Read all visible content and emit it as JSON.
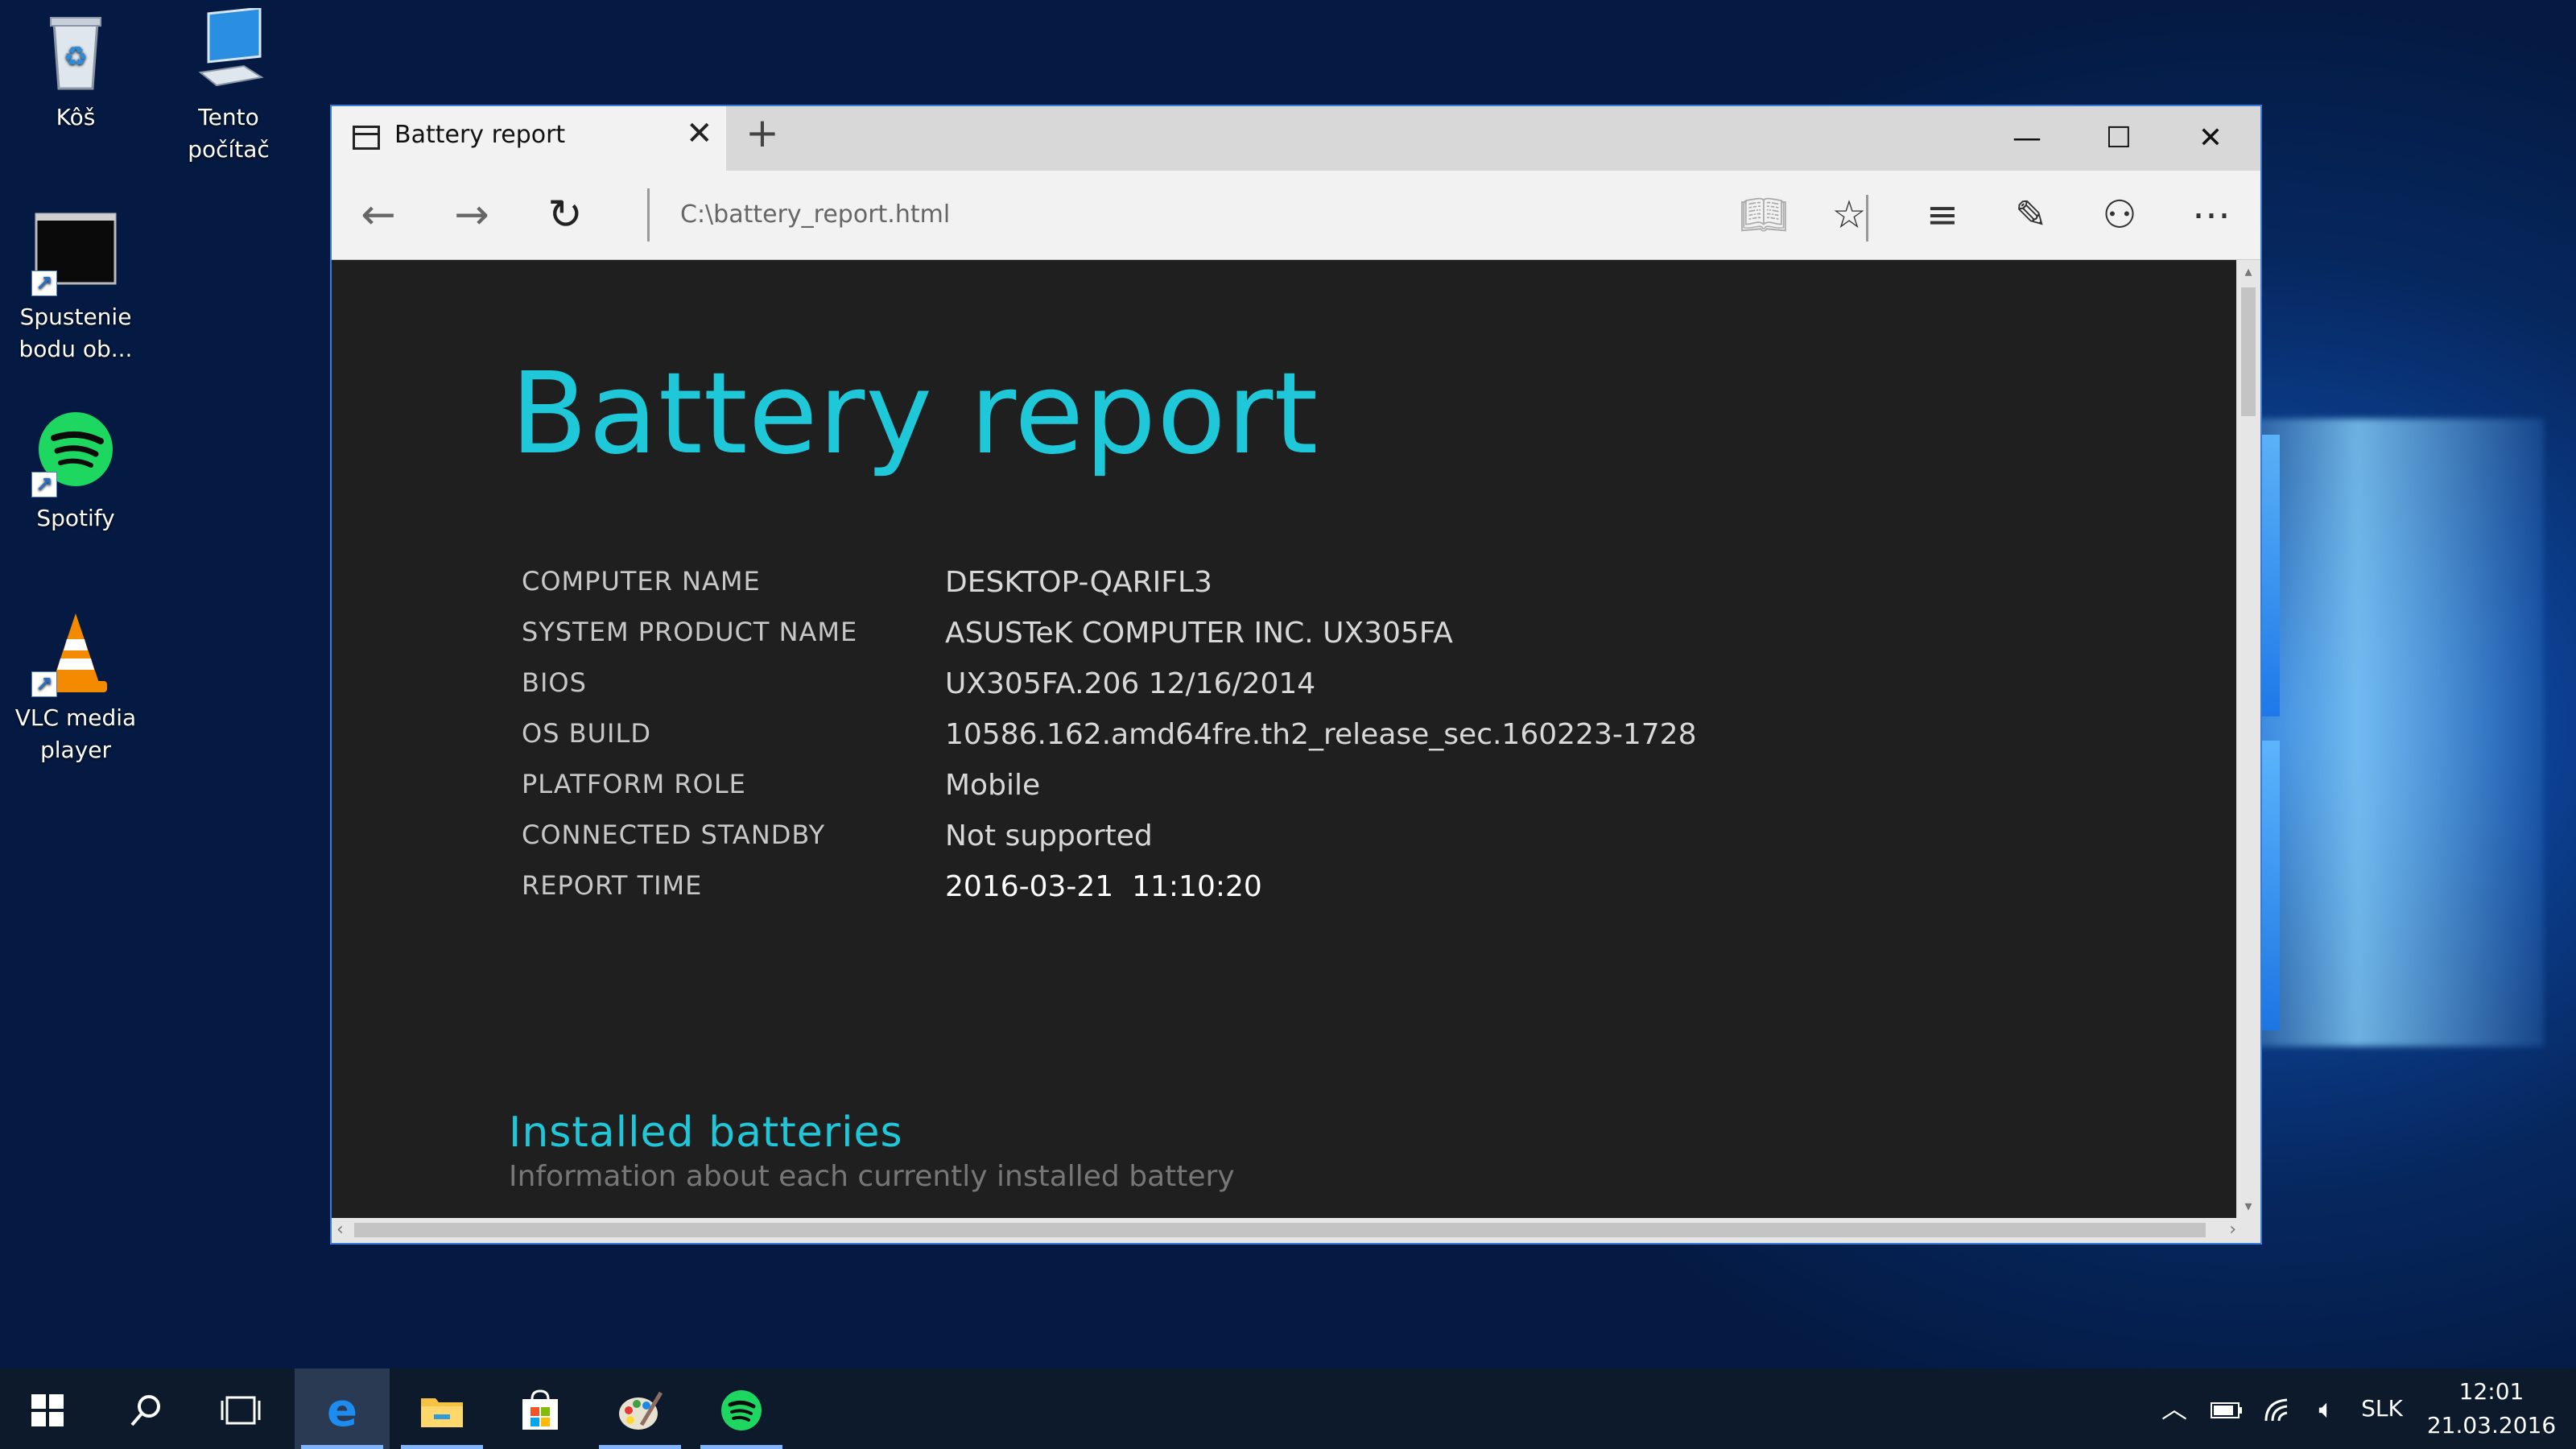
{
  "desktop": {
    "icons": [
      {
        "label": "Kôš",
        "icon": "recycle-bin-icon"
      },
      {
        "label": "Tento počítač",
        "icon": "this-pc-icon"
      },
      {
        "label": "Spustenie bodu ob...",
        "icon": "restore-point-icon"
      },
      {
        "label": "Spotify",
        "icon": "spotify-icon"
      },
      {
        "label": "VLC media player",
        "icon": "vlc-icon"
      }
    ]
  },
  "browser": {
    "tab_title": "Battery report",
    "address": "C:\\battery_report.html",
    "accent_color": "#1fc8d9"
  },
  "report": {
    "title": "Battery report",
    "rows": [
      {
        "label": "COMPUTER NAME",
        "value": "DESKTOP-QARIFL3"
      },
      {
        "label": "SYSTEM PRODUCT NAME",
        "value": "ASUSTeK COMPUTER INC. UX305FA"
      },
      {
        "label": "BIOS",
        "value": "UX305FA.206 12/16/2014"
      },
      {
        "label": "OS BUILD",
        "value": "10586.162.amd64fre.th2_release_sec.160223-1728"
      },
      {
        "label": "PLATFORM ROLE",
        "value": "Mobile"
      },
      {
        "label": "CONNECTED STANDBY",
        "value": "Not supported"
      },
      {
        "label": "REPORT TIME",
        "value": "2016-03-21  11:10:20"
      }
    ],
    "section_title": "Installed batteries",
    "section_subtitle": "Information about each currently installed battery"
  },
  "taskbar": {
    "language": "SLK",
    "time": "12:01",
    "date": "21.03.2016"
  }
}
